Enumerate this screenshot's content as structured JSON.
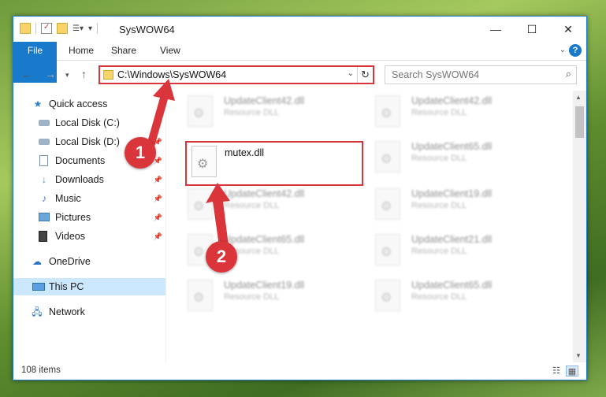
{
  "window": {
    "title": "SysWOW64",
    "qat_icons": [
      "folder-icon",
      "properties-icon",
      "new-folder-icon",
      "customize-icon"
    ],
    "controls": [
      "minimize-icon",
      "maximize-icon",
      "close-icon"
    ],
    "accent": "#1979ca"
  },
  "ribbon": {
    "tabs": [
      "File",
      "Home",
      "Share",
      "View"
    ]
  },
  "address": {
    "path": "C:\\Windows\\SysWOW64"
  },
  "search": {
    "placeholder": "Search SysWOW64"
  },
  "sidebar": {
    "items": [
      {
        "label": "Quick access",
        "icon": "star-icon",
        "pinned": false
      },
      {
        "label": "Local Disk (C:)",
        "icon": "drive-icon",
        "pinned": true
      },
      {
        "label": "Local Disk (D:)",
        "icon": "drive-icon",
        "pinned": true
      },
      {
        "label": "Documents",
        "icon": "documents-icon",
        "pinned": true
      },
      {
        "label": "Downloads",
        "icon": "downloads-icon",
        "pinned": true
      },
      {
        "label": "Music",
        "icon": "music-icon",
        "pinned": true
      },
      {
        "label": "Pictures",
        "icon": "pictures-icon",
        "pinned": true
      },
      {
        "label": "Videos",
        "icon": "videos-icon",
        "pinned": true
      },
      {
        "label": "OneDrive",
        "icon": "onedrive-icon",
        "pinned": false
      },
      {
        "label": "This PC",
        "icon": "computer-icon",
        "pinned": false,
        "selected": true
      },
      {
        "label": "Network",
        "icon": "network-icon",
        "pinned": false
      }
    ]
  },
  "files": [
    {
      "name": "UpdateClient42.dll",
      "type": "Resource DLL",
      "blurred": true
    },
    {
      "name": "UpdateClient42.dll",
      "type": "Resource DLL",
      "blurred": true
    },
    {
      "name": "mutex.dll",
      "type": "",
      "blurred": false,
      "highlighted": true
    },
    {
      "name": "UpdateClient65.dll",
      "type": "Resource DLL",
      "blurred": true
    },
    {
      "name": "UpdateClient42.dll",
      "type": "Resource DLL",
      "blurred": true
    },
    {
      "name": "UpdateClient19.dll",
      "type": "Resource DLL",
      "blurred": true
    },
    {
      "name": "UpdateClient65.dll",
      "type": "Resource DLL",
      "blurred": true
    },
    {
      "name": "UpdateClient21.dll",
      "type": "Resource DLL",
      "blurred": true
    },
    {
      "name": "UpdateClient19.dll",
      "type": "Resource DLL",
      "blurred": true
    },
    {
      "name": "UpdateClient65.dll",
      "type": "Resource DLL",
      "blurred": true
    }
  ],
  "status": {
    "count": "108 items"
  },
  "annotations": {
    "callout_1": "1",
    "callout_2": "2",
    "color": "#d9353a"
  }
}
